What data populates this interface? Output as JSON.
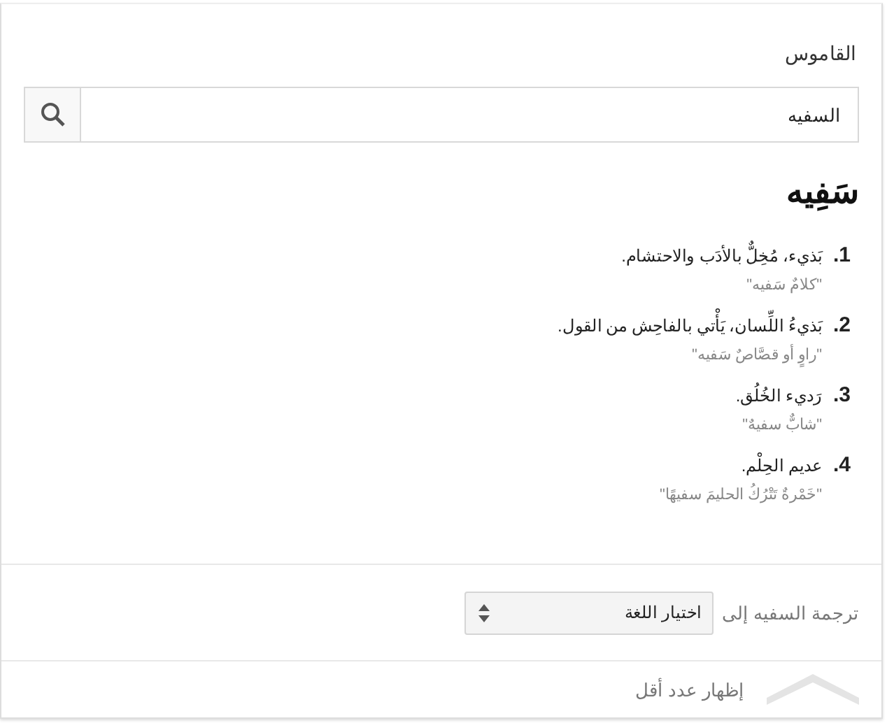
{
  "title": "القاموس",
  "search": {
    "value": "السفيه"
  },
  "headword": "سَفِيه",
  "definitions": [
    {
      "number": "1.",
      "text": "بَذيء، مُخِلٌّ بالأدَب والاحتشام.",
      "example": "\"كلامٌ سَفيه\""
    },
    {
      "number": "2.",
      "text": "بَذيءُ اللِّسان، يَأْتي بالفاحِش من القول.",
      "example": "\"راوٍ أو قصَّاصٌ سَفيه\""
    },
    {
      "number": "3.",
      "text": "رَديء الخُلُق.",
      "example": "\"شابٌّ سفيهٌ\""
    },
    {
      "number": "4.",
      "text": "عديم الحِلْم.",
      "example": "\"خَمْرةٌ تَتْرُكُ الحليمَ سفيهًا\""
    }
  ],
  "translate": {
    "label": "ترجمة السفيه إلى",
    "select": "اختيار اللغة"
  },
  "footer": {
    "label": "إظهار عدد أقل"
  }
}
